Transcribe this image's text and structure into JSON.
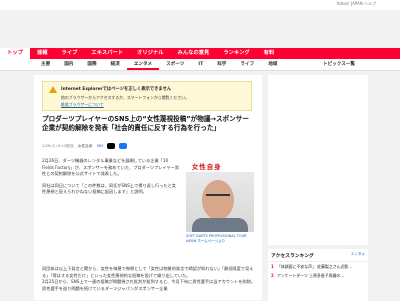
{
  "top_links": "Yahoo! JAPAN ヘルプ",
  "nav": {
    "items": [
      "トップ",
      "速報",
      "ライブ",
      "エキスパート",
      "オリジナル",
      "みんなの意見",
      "ランキング",
      "有料"
    ],
    "active_index": 0
  },
  "subnav": {
    "items": [
      "主要",
      "国内",
      "国際",
      "経済",
      "エンタメ",
      "スポーツ",
      "IT",
      "科学",
      "ライフ",
      "地域"
    ],
    "active_index": 4,
    "right_label": "トピックス一覧"
  },
  "notice": {
    "title": "Internet Explorerではページを正しく表示できません",
    "line1": "他のブラウザーからアクセスするか、スマートフォンから閲覧ください。",
    "link": "推奨ブラウザーについて"
  },
  "article": {
    "title": "プロダーツプレイヤーのSNS上の“女性蔑視投稿”が物議→スポンサー企業が契約解除を発表「社会的責任に反する行為を行った」",
    "date": "2/26(火) 8:10配信",
    "source": "女性自身",
    "comments": "363",
    "p1": "2月26日、ダーツ機器のレンタル事業などを展開している企業「10 Fields Factory」が、スポンサーを務めていた、プロダーツプレイヤー男性との契約解除を公式サイトで発表した。",
    "p2": "同社は同日について「この件数は、同氏がSNS上で掲り返し行ったと女性蔑視と捉えられかねない投稿に起因します」と説明。",
    "p3": "同団体は以上下発言と関から、女性を侮蔑で侮辱として「女性は物質的発言で師認が知れない」「最低限度で見える」「得はする女性だけ」といった女性蔑視的な投稿を投げて繰り出していた。",
    "p4": "2月25日から、SNS上で一連の投稿が問題視され批判が殺到すると、今月下旬に男性選手は当アカウントを削除。男性選手を巡り問題を続けているダーツジャパンがスポンサー企業"
  },
  "photo": {
    "logo": "女性自身",
    "caption": "SOFT DARTS PROFESSIONAL TOUR JAPAN ホームページより"
  },
  "ranking": {
    "title": "アクセスランキング",
    "more": "エンタメ",
    "items": [
      {
        "num": "1",
        "text": "「体調面に不安な声」 佐藤製之さん近影…"
      },
      {
        "num": "2",
        "text": "アンケートダーツ 上原多香子再婚の…"
      }
    ]
  }
}
